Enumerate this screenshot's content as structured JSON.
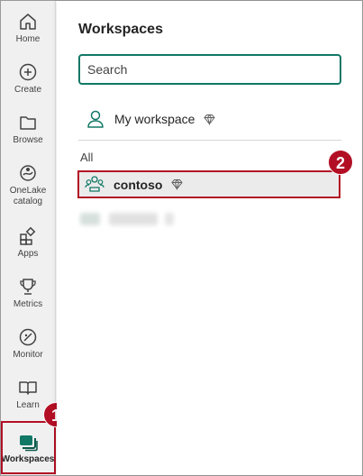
{
  "rail": {
    "items": [
      {
        "label": "Home",
        "icon": "home-icon"
      },
      {
        "label": "Create",
        "icon": "plus-circle-icon"
      },
      {
        "label": "Browse",
        "icon": "folder-icon"
      },
      {
        "label_line1": "OneLake",
        "label_line2": "catalog",
        "icon": "onelake-icon"
      },
      {
        "label": "Apps",
        "icon": "apps-icon"
      },
      {
        "label": "Metrics",
        "icon": "trophy-icon"
      },
      {
        "label": "Monitor",
        "icon": "monitor-icon"
      },
      {
        "label": "Learn",
        "icon": "book-icon"
      },
      {
        "label": "Workspaces",
        "icon": "workspaces-icon",
        "active": true
      }
    ]
  },
  "panel": {
    "title": "Workspaces",
    "search_placeholder": "Search",
    "my_workspace_label": "My workspace",
    "section_label": "All",
    "workspaces": [
      {
        "name": "contoso",
        "selected": true
      }
    ]
  },
  "callouts": {
    "first": "1",
    "second": "2"
  },
  "colors": {
    "accent": "#117865",
    "callout": "#b30f24",
    "rail_bg": "#f0f0f0"
  }
}
